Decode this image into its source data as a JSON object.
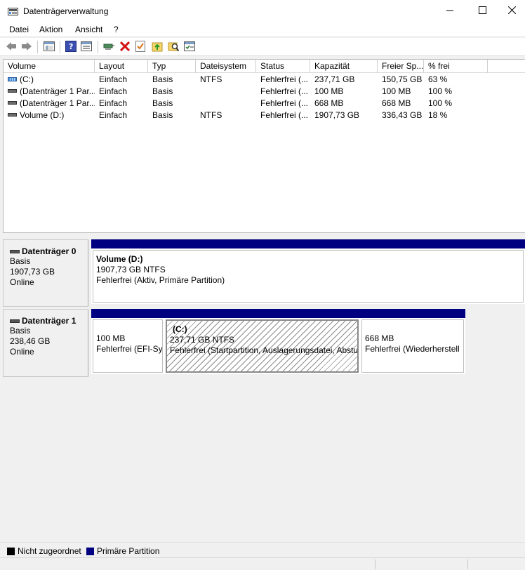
{
  "window": {
    "title": "Datenträgerverwaltung"
  },
  "menu": [
    "Datei",
    "Aktion",
    "Ansicht",
    "?"
  ],
  "toolbar": {
    "icons": [
      "back-icon",
      "forward-icon",
      "console-tree-icon",
      "help-icon",
      "properties-icon",
      "connect-icon",
      "delete-icon",
      "check-icon",
      "import-icon",
      "search-icon",
      "settings-icon"
    ]
  },
  "list": {
    "columns": [
      "Volume",
      "Layout",
      "Typ",
      "Dateisystem",
      "Status",
      "Kapazität",
      "Freier Sp...",
      "% frei"
    ],
    "rows": [
      {
        "volume": "(C:)",
        "layout": "Einfach",
        "typ": "Basis",
        "dateisystem": "NTFS",
        "status": "Fehlerfrei (...",
        "kapazitaet": "237,71 GB",
        "frei": "150,75 GB",
        "prozent": "63 %"
      },
      {
        "volume": "(Datenträger 1 Par...",
        "layout": "Einfach",
        "typ": "Basis",
        "dateisystem": "",
        "status": "Fehlerfrei (...",
        "kapazitaet": "100 MB",
        "frei": "100 MB",
        "prozent": "100 %"
      },
      {
        "volume": "(Datenträger 1 Par...",
        "layout": "Einfach",
        "typ": "Basis",
        "dateisystem": "",
        "status": "Fehlerfrei (...",
        "kapazitaet": "668 MB",
        "frei": "668 MB",
        "prozent": "100 %"
      },
      {
        "volume": "Volume (D:)",
        "layout": "Einfach",
        "typ": "Basis",
        "dateisystem": "NTFS",
        "status": "Fehlerfrei (...",
        "kapazitaet": "1907,73 GB",
        "frei": "336,43 GB",
        "prozent": "18 %"
      }
    ]
  },
  "disks": [
    {
      "name": "Datenträger 0",
      "type": "Basis",
      "size": "1907,73 GB",
      "state": "Online",
      "partitions": [
        {
          "title": "Volume  (D:)",
          "size": "1907,73 GB NTFS",
          "status": "Fehlerfrei (Aktiv, Primäre Partition)"
        }
      ]
    },
    {
      "name": "Datenträger 1",
      "type": "Basis",
      "size": "238,46 GB",
      "state": "Online",
      "partitions": [
        {
          "title": "",
          "size": "100 MB",
          "status": "Fehlerfrei (EFI-Sy"
        },
        {
          "title": "(C:)",
          "size": "237,71 GB NTFS",
          "status": "Fehlerfrei (Startpartition, Auslagerungsdatei, Abstu"
        },
        {
          "title": "",
          "size": "668 MB",
          "status": "Fehlerfrei (Wiederherstell"
        }
      ]
    }
  ],
  "legend": [
    {
      "label": "Nicht zugeordnet",
      "color": "#000000"
    },
    {
      "label": "Primäre Partition",
      "color": "#000080"
    }
  ]
}
